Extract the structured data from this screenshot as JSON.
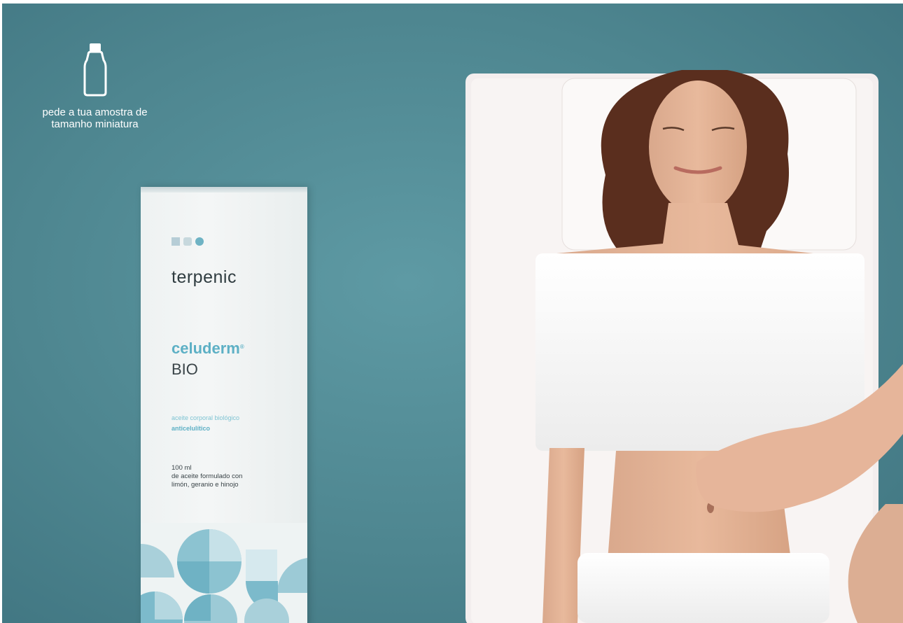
{
  "sample": {
    "icon": "bottle-icon",
    "line1": "pede a tua amostra de",
    "line2": "tamanho miniatura"
  },
  "product": {
    "brand": "terpenic",
    "name": "celuderm",
    "name_mark": "®",
    "subname": "BIO",
    "description_line1": "aceite corporal biológico",
    "description_line2": "anticelulítico",
    "volume": "100 ml",
    "composition_line1": "de aceite formulado con",
    "composition_line2": "limón, geranio e hinojo"
  },
  "colors": {
    "background": "#4e8690",
    "brand_accent": "#5db0c5",
    "box": "#f1f4f4"
  }
}
